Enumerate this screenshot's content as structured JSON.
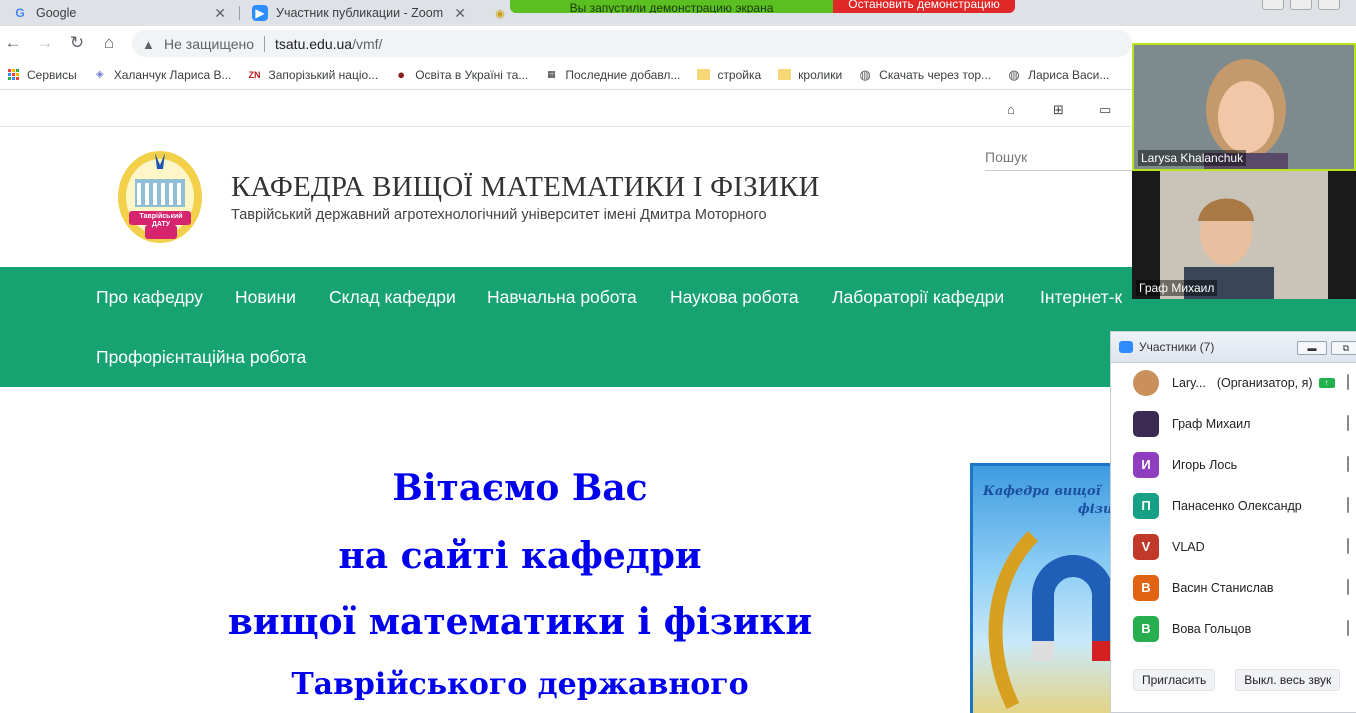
{
  "browser": {
    "tabs": [
      {
        "label": "Google"
      },
      {
        "label": "Участник публикации - Zoom"
      }
    ],
    "address": {
      "security": "Не защищено",
      "host": "tsatu.edu.ua",
      "path": "/vmf/"
    },
    "bookmarks": [
      {
        "label": "Сервисы"
      },
      {
        "label": "Халанчук Лариса В..."
      },
      {
        "label": "Запорізький націо..."
      },
      {
        "label": "Освіта в Україні та..."
      },
      {
        "label": "Последние добавл..."
      },
      {
        "label": "стройка"
      },
      {
        "label": "кролики"
      },
      {
        "label": "Скачать через тор..."
      },
      {
        "label": "Лариса Васи..."
      }
    ]
  },
  "share_bar": {
    "status": "Вы запустили демонстрацию экрана",
    "stop_label": "Остановить демонстрацию"
  },
  "site": {
    "title": "КАФЕДРА ВИЩОЇ МАТЕМАТИКИ І ФІЗИКИ",
    "subtitle": "Таврійський державний агротехнологічний університет імені Дмитра Моторного",
    "search_placeholder": "Пошук",
    "logo_text": "Таврійський ДАТУ",
    "menu": [
      {
        "label": "Про кафедру"
      },
      {
        "label": "Новини"
      },
      {
        "label": "Склад кафедри"
      },
      {
        "label": "Навчальна робота"
      },
      {
        "label": "Наукова робота"
      },
      {
        "label": "Лабораторії кафедри"
      },
      {
        "label": "Інтернет-к"
      },
      {
        "label": "Профорієнтаційна робота"
      }
    ],
    "welcome": [
      "Вітаємо Вас",
      "на сайті кафедри",
      "вищої математики і фізики",
      "Таврійського державного"
    ],
    "poster_text_1": "Кафедра вищої",
    "poster_text_2": "фізи"
  },
  "zoom": {
    "video_tiles": [
      {
        "name": "Larysa Khalanchuk"
      },
      {
        "name": "Граф Михаил"
      }
    ],
    "panel_title": "Участники (7)",
    "participants": [
      {
        "name": "Lary...",
        "role": "(Организатор, я)",
        "initial": "",
        "color": "#c9905b"
      },
      {
        "name": "Граф Михаил",
        "initial": "",
        "color": "#3b2a52"
      },
      {
        "name": "Игорь Лось",
        "initial": "И",
        "color": "#8e3fbf"
      },
      {
        "name": "Панасенко Олександр",
        "initial": "П",
        "color": "#16a085"
      },
      {
        "name": "VLAD",
        "initial": "V",
        "color": "#c0392b"
      },
      {
        "name": "Васин Станислав",
        "initial": "В",
        "color": "#e06414"
      },
      {
        "name": "Вова Гольцов",
        "initial": "В",
        "color": "#27ae4f"
      }
    ],
    "invite_label": "Пригласить",
    "mute_all_label": "Выкл. весь звук"
  }
}
